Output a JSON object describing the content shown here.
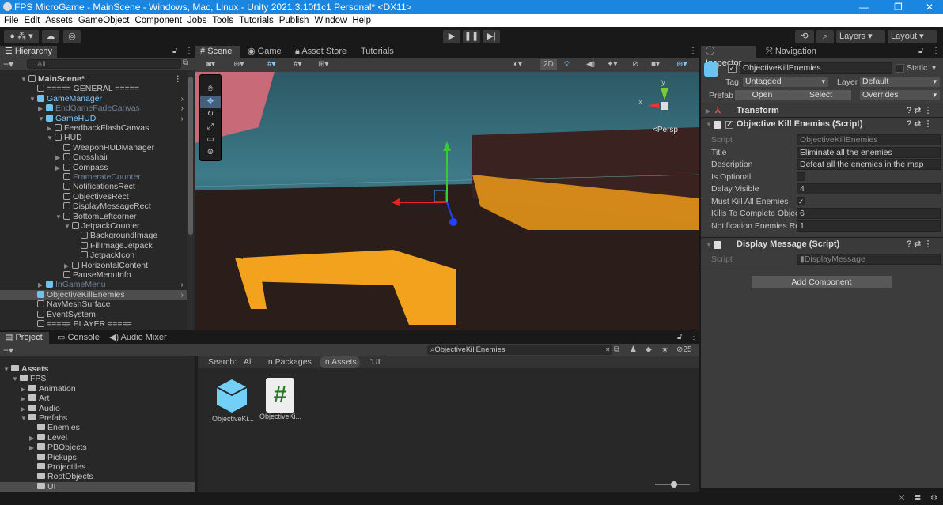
{
  "window": {
    "title": "FPS MicroGame - MainScene - Windows, Mac, Linux - Unity 2021.3.10f1c1 Personal* <DX11>"
  },
  "menu": [
    "File",
    "Edit",
    "Assets",
    "GameObject",
    "Component",
    "Jobs",
    "Tools",
    "Tutorials",
    "Publish",
    "Window",
    "Help"
  ],
  "toolbar": {
    "layers": "Layers",
    "layout": "Layout"
  },
  "hierarchy": {
    "tab": "Hierarchy",
    "search_placeholder": "All",
    "items": [
      {
        "label": "MainScene*",
        "level": 0,
        "arrow": "open",
        "kind": "scene"
      },
      {
        "label": "===== GENERAL =====",
        "level": 1,
        "arrow": "",
        "kind": "go"
      },
      {
        "label": "GameManager",
        "level": 1,
        "arrow": "open",
        "kind": "prefab"
      },
      {
        "label": "EndGameFadeCanvas",
        "level": 2,
        "arrow": "closed",
        "kind": "prefab-dim"
      },
      {
        "label": "GameHUD",
        "level": 2,
        "arrow": "open",
        "kind": "prefab"
      },
      {
        "label": "FeedbackFlashCanvas",
        "level": 3,
        "arrow": "closed",
        "kind": "go"
      },
      {
        "label": "HUD",
        "level": 3,
        "arrow": "open",
        "kind": "go"
      },
      {
        "label": "WeaponHUDManager",
        "level": 4,
        "arrow": "",
        "kind": "go"
      },
      {
        "label": "Crosshair",
        "level": 4,
        "arrow": "closed",
        "kind": "go"
      },
      {
        "label": "Compass",
        "level": 4,
        "arrow": "closed",
        "kind": "go"
      },
      {
        "label": "FramerateCounter",
        "level": 4,
        "arrow": "",
        "kind": "dim"
      },
      {
        "label": "NotificationsRect",
        "level": 4,
        "arrow": "",
        "kind": "go"
      },
      {
        "label": "ObjectivesRect",
        "level": 4,
        "arrow": "",
        "kind": "go"
      },
      {
        "label": "DisplayMessageRect",
        "level": 4,
        "arrow": "",
        "kind": "go"
      },
      {
        "label": "BottomLeftcorner",
        "level": 4,
        "arrow": "open",
        "kind": "go"
      },
      {
        "label": "JetpackCounter",
        "level": 5,
        "arrow": "open",
        "kind": "go"
      },
      {
        "label": "BackgroundImage",
        "level": 6,
        "arrow": "",
        "kind": "go"
      },
      {
        "label": "FillImageJetpack",
        "level": 6,
        "arrow": "",
        "kind": "go"
      },
      {
        "label": "JetpackIcon",
        "level": 6,
        "arrow": "",
        "kind": "go"
      },
      {
        "label": "HorizontalContent",
        "level": 5,
        "arrow": "closed",
        "kind": "go"
      },
      {
        "label": "PauseMenuInfo",
        "level": 4,
        "arrow": "",
        "kind": "go"
      },
      {
        "label": "InGameMenu",
        "level": 2,
        "arrow": "closed",
        "kind": "prefab-dim"
      },
      {
        "label": "ObjectiveKillEnemies",
        "level": 1,
        "arrow": "",
        "kind": "prefab-sel"
      },
      {
        "label": "NavMeshSurface",
        "level": 1,
        "arrow": "",
        "kind": "go"
      },
      {
        "label": "EventSystem",
        "level": 1,
        "arrow": "",
        "kind": "go"
      },
      {
        "label": "===== PLAYER =====",
        "level": 1,
        "arrow": "",
        "kind": "go"
      },
      {
        "label": "Player",
        "level": 1,
        "arrow": "closed",
        "kind": "prefab"
      }
    ]
  },
  "scene": {
    "tabs": [
      "Scene",
      "Game",
      "Asset Store",
      "Tutorials"
    ],
    "mode_2d": "2D",
    "persp": "<Persp",
    "axis_y": "y",
    "axis_x": "x"
  },
  "inspector": {
    "tabs": [
      "Inspector",
      "Navigation"
    ],
    "object_name": "ObjectiveKillEnemies",
    "static_label": "Static",
    "tag_label": "Tag",
    "tag": "Untagged",
    "layer_label": "Layer",
    "layer": "Default",
    "prefab_label": "Prefab",
    "open": "Open",
    "select": "Select",
    "overrides": "Overrides",
    "transform": "Transform",
    "comp1": {
      "title": "Objective Kill Enemies (Script)",
      "fields": [
        {
          "label": "Script",
          "value": "ObjectiveKillEnemies",
          "type": "script"
        },
        {
          "label": "Title",
          "value": "Eliminate all the enemies",
          "type": "text"
        },
        {
          "label": "Description",
          "value": "Defeat all the enemies in the map",
          "type": "text"
        },
        {
          "label": "Is Optional",
          "value": "",
          "type": "check-off"
        },
        {
          "label": "Delay Visible",
          "value": "4",
          "type": "text"
        },
        {
          "label": "Must Kill All Enemies",
          "value": "✓",
          "type": "check-on"
        },
        {
          "label": "Kills To Complete Objec",
          "value": "6",
          "type": "text"
        },
        {
          "label": "Notification Enemies Re",
          "value": "1",
          "type": "text"
        }
      ]
    },
    "comp2": {
      "title": "Display Message (Script)",
      "script_label": "Script",
      "script": "DisplayMessage"
    },
    "add_component": "Add Component"
  },
  "project": {
    "tabs": [
      "Project",
      "Console",
      "Audio Mixer"
    ],
    "tree": [
      {
        "label": "Assets",
        "level": 0,
        "arrow": "open"
      },
      {
        "label": "FPS",
        "level": 1,
        "arrow": "open"
      },
      {
        "label": "Animation",
        "level": 2,
        "arrow": "closed"
      },
      {
        "label": "Art",
        "level": 2,
        "arrow": "closed"
      },
      {
        "label": "Audio",
        "level": 2,
        "arrow": "closed"
      },
      {
        "label": "Prefabs",
        "level": 2,
        "arrow": "open"
      },
      {
        "label": "Enemies",
        "level": 3,
        "arrow": ""
      },
      {
        "label": "Level",
        "level": 3,
        "arrow": "closed"
      },
      {
        "label": "PBObjects",
        "level": 3,
        "arrow": "closed"
      },
      {
        "label": "Pickups",
        "level": 3,
        "arrow": ""
      },
      {
        "label": "Projectiles",
        "level": 3,
        "arrow": ""
      },
      {
        "label": "RootObjects",
        "level": 3,
        "arrow": ""
      },
      {
        "label": "UI",
        "level": 3,
        "arrow": "",
        "sel": true
      }
    ],
    "search": "ObjectiveKillEnemies",
    "hidden_count": "25",
    "search_label": "Search:",
    "filters": [
      "All",
      "In Packages",
      "In Assets",
      "'UI'"
    ],
    "assets": [
      {
        "label": "ObjectiveKi...",
        "type": "prefab"
      },
      {
        "label": "ObjectiveKi...",
        "type": "script"
      }
    ]
  },
  "colors": {
    "accent": "#1b86e0",
    "selection": "#4d4d4d",
    "prefab": "#7ec8ff"
  }
}
